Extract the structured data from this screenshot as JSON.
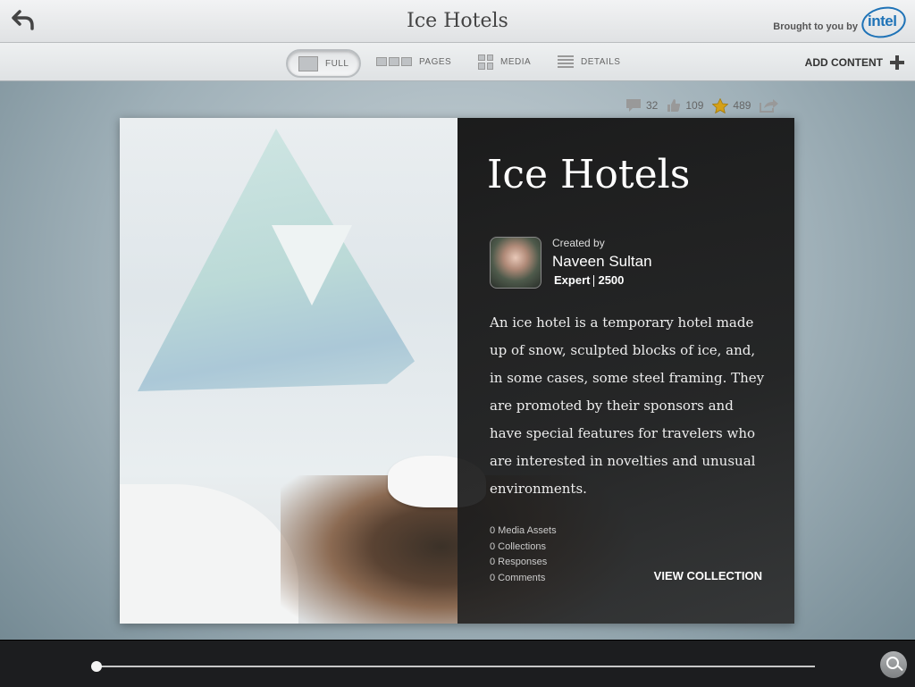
{
  "header": {
    "title": "Ice Hotels",
    "brought_by": "Brought to you by",
    "brand": "intel"
  },
  "toolbar": {
    "tabs": [
      {
        "label": "FULL"
      },
      {
        "label": "PAGES"
      },
      {
        "label": "MEDIA"
      },
      {
        "label": "DETAILS"
      }
    ],
    "add_content": "ADD CONTENT"
  },
  "stats": {
    "comments": "32",
    "likes": "109",
    "stars": "489"
  },
  "card": {
    "title": "Ice Hotels",
    "created_by_label": "Created by",
    "author": "Naveen Sultan",
    "level": "Expert",
    "points": "2500",
    "description": "An ice hotel is a temporary hotel made up of snow, sculpted blocks of ice, and, in some cases, some steel framing. They are promoted by their sponsors and have special features for travelers who are interested in novelties and unusual environments.",
    "counts": [
      "0 Media Assets",
      "0 Collections",
      "0 Responses",
      "0 Comments"
    ],
    "view_collection": "VIEW COLLECTION"
  },
  "colors": {
    "brand_blue": "#1f73b7",
    "panel_bg": "#1b1b1b",
    "bottombar_bg": "#1c1d1f"
  },
  "icons": {
    "back": "back-arrow-icon",
    "comment": "comment-icon",
    "like": "thumbs-up-icon",
    "star": "star-icon",
    "share": "share-icon",
    "search": "search-icon"
  }
}
